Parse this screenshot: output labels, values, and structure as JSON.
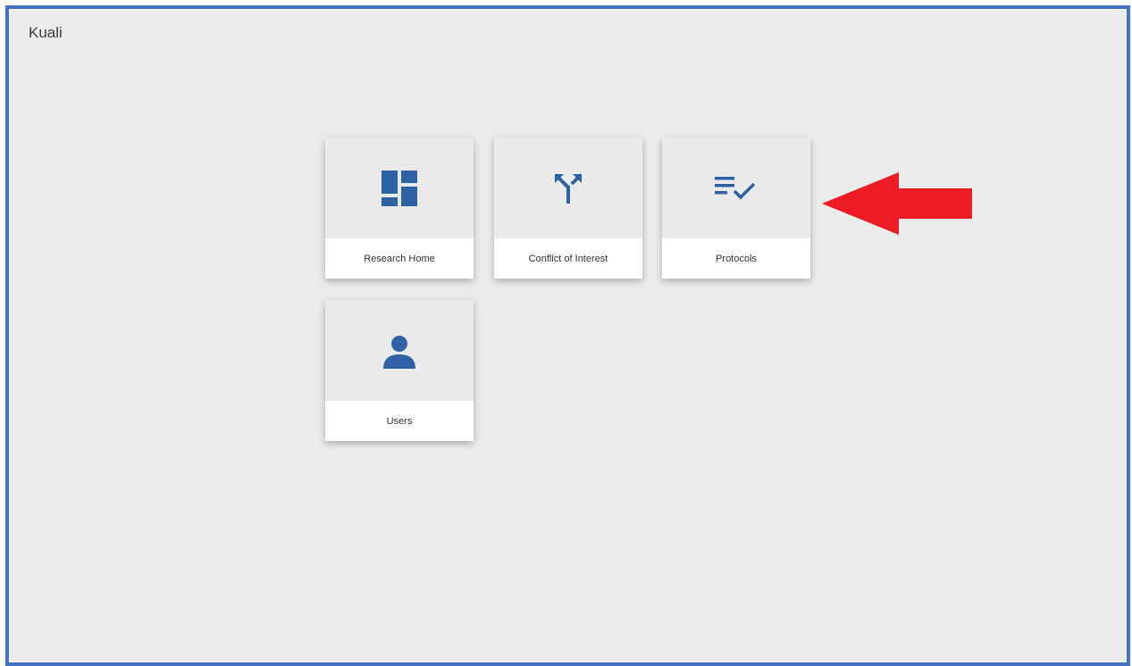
{
  "app": {
    "title": "Kuali"
  },
  "tiles": [
    {
      "label": "Research Home",
      "icon": "dashboard-icon"
    },
    {
      "label": "Conflict of Interest",
      "icon": "call-split-icon"
    },
    {
      "label": "Protocols",
      "icon": "playlist-check-icon"
    },
    {
      "label": "Users",
      "icon": "person-icon"
    }
  ],
  "colors": {
    "frame_border": "#4472c4",
    "icon": "#2f62a5",
    "arrow": "#ed1c24",
    "background": "#ececeb"
  }
}
